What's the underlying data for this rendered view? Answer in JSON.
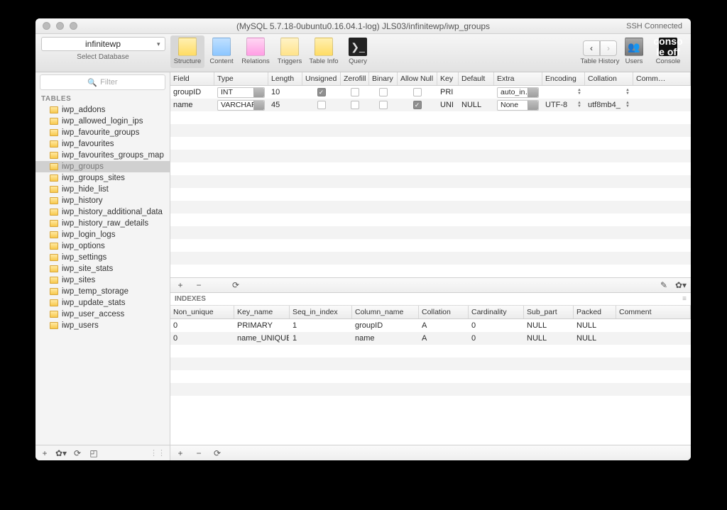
{
  "window": {
    "title": "(MySQL 5.7.18-0ubuntu0.16.04.1-log) JLS03/infinitewp/iwp_groups",
    "ssh_label": "SSH Connected"
  },
  "toolbar": {
    "db_selected": "infinitewp",
    "select_db_label": "Select Database",
    "tabs": {
      "structure": "Structure",
      "content": "Content",
      "relations": "Relations",
      "triggers": "Triggers",
      "tableinfo": "Table Info",
      "query": "Query"
    },
    "history_label": "Table History",
    "users_label": "Users",
    "console_label": "Console",
    "console_glyph": "conso\nle off"
  },
  "sidebar": {
    "filter_placeholder": "Filter",
    "section_label": "TABLES",
    "tables": [
      "iwp_addons",
      "iwp_allowed_login_ips",
      "iwp_favourite_groups",
      "iwp_favourites",
      "iwp_favourites_groups_map",
      "iwp_groups",
      "iwp_groups_sites",
      "iwp_hide_list",
      "iwp_history",
      "iwp_history_additional_data",
      "iwp_history_raw_details",
      "iwp_login_logs",
      "iwp_options",
      "iwp_settings",
      "iwp_site_stats",
      "iwp_sites",
      "iwp_temp_storage",
      "iwp_update_stats",
      "iwp_user_access",
      "iwp_users"
    ],
    "selected": "iwp_groups"
  },
  "fields": {
    "headers": [
      "Field",
      "Type",
      "Length",
      "Unsigned",
      "Zerofill",
      "Binary",
      "Allow Null",
      "Key",
      "Default",
      "Extra",
      "Encoding",
      "Collation",
      "Comm…"
    ],
    "rows": [
      {
        "field": "groupID",
        "type": "INT",
        "length": "10",
        "unsigned": true,
        "zerofill": false,
        "binary": false,
        "allow_null": false,
        "key": "PRI",
        "default": "",
        "extra": "auto_in…",
        "encoding": "",
        "collation": ""
      },
      {
        "field": "name",
        "type": "VARCHAR",
        "length": "45",
        "unsigned": false,
        "zerofill": false,
        "binary": false,
        "allow_null": true,
        "key": "UNI",
        "default": "NULL",
        "extra": "None",
        "encoding": "UTF-8",
        "collation": "utf8mb4_"
      }
    ]
  },
  "index_panel": {
    "title": "INDEXES",
    "headers": [
      "Non_unique",
      "Key_name",
      "Seq_in_index",
      "Column_name",
      "Collation",
      "Cardinality",
      "Sub_part",
      "Packed",
      "Comment"
    ],
    "rows": [
      {
        "non_unique": "0",
        "key_name": "PRIMARY",
        "seq": "1",
        "column": "groupID",
        "collation": "A",
        "cardinality": "0",
        "sub_part": "NULL",
        "packed": "NULL",
        "comment": ""
      },
      {
        "non_unique": "0",
        "key_name": "name_UNIQUE",
        "seq": "1",
        "column": "name",
        "collation": "A",
        "cardinality": "0",
        "sub_part": "NULL",
        "packed": "NULL",
        "comment": ""
      }
    ]
  },
  "glyphs": {
    "plus": "+",
    "minus": "−",
    "dup": "⵬",
    "refresh": "⟳",
    "gear": "✿▾",
    "pencil": "✎",
    "window": "◰",
    "search": "🔍",
    "left": "‹",
    "right": "›"
  }
}
